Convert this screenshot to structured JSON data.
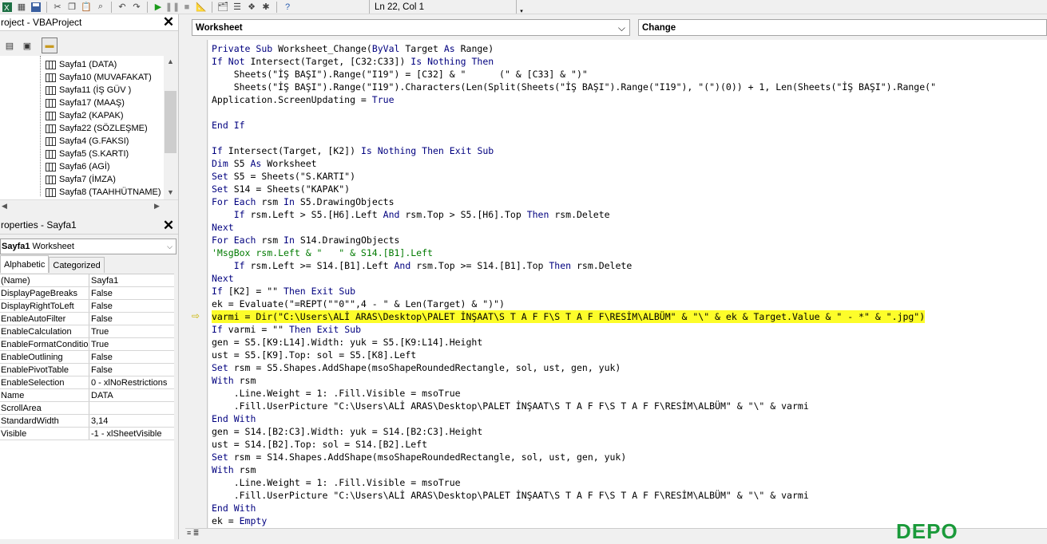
{
  "toolbar": {
    "status": "Ln 22, Col 1",
    "icons": [
      "excel-icon",
      "insert-module-icon",
      "save-icon",
      "cut-icon",
      "copy-icon",
      "paste-icon",
      "find-icon",
      "undo-icon",
      "redo-icon",
      "run-icon",
      "break-icon",
      "reset-icon",
      "design-mode-icon",
      "project-explorer-icon",
      "properties-icon",
      "object-browser-icon",
      "toolbox-icon",
      "help-icon"
    ]
  },
  "project": {
    "title": "roject - VBAProject",
    "close": "✕",
    "items": [
      "Sayfa1 (DATA)",
      "Sayfa10 (MUVAFAKAT)",
      "Sayfa11 (İŞ GÜV )",
      "Sayfa17 (MAAŞ)",
      "Sayfa2 (KAPAK)",
      "Sayfa22 (SÖZLEŞME)",
      "Sayfa4 (G.FAKSI)",
      "Sayfa5 (S.KARTI)",
      "Sayfa6 (AGİ)",
      "Sayfa7 (İMZA)",
      "Sayfa8 (TAAHHÜTNAME)"
    ]
  },
  "properties": {
    "title": "roperties - Sayfa1",
    "close": "✕",
    "object_name": "Sayfa1",
    "object_type": "Worksheet",
    "tabs": [
      "Alphabetic",
      "Categorized"
    ],
    "rows": [
      [
        "(Name)",
        "Sayfa1"
      ],
      [
        "DisplayPageBreaks",
        "False"
      ],
      [
        "DisplayRightToLeft",
        "False"
      ],
      [
        "EnableAutoFilter",
        "False"
      ],
      [
        "EnableCalculation",
        "True"
      ],
      [
        "EnableFormatConditionsCalculation",
        "True"
      ],
      [
        "EnableOutlining",
        "False"
      ],
      [
        "EnablePivotTable",
        "False"
      ],
      [
        "EnableSelection",
        "0 - xlNoRestrictions"
      ],
      [
        "Name",
        "DATA"
      ],
      [
        "ScrollArea",
        ""
      ],
      [
        "StandardWidth",
        "3,14"
      ],
      [
        "Visible",
        "-1 - xlSheetVisible"
      ]
    ]
  },
  "code": {
    "object_combo": "Worksheet",
    "procedure_combo": "Change",
    "lines": [
      "Private Sub Worksheet_Change(ByVal Target As Range)",
      "If Not Intersect(Target, [C32:C33]) Is Nothing Then",
      "    Sheets(\"İŞ BAŞI\").Range(\"I19\") = [C32] & \"      (\" & [C33] & \")\"",
      "    Sheets(\"İŞ BAŞI\").Range(\"I19\").Characters(Len(Split(Sheets(\"İŞ BAŞI\").Range(\"I19\"), \"(\")(0)) + 1, Len(Sheets(\"İŞ BAŞI\").Range(\"",
      "Application.ScreenUpdating = True",
      "",
      "End If",
      "",
      "If Intersect(Target, [K2]) Is Nothing Then Exit Sub",
      "Dim S5 As Worksheet",
      "Set S5 = Sheets(\"S.KARTI\")",
      "Set S14 = Sheets(\"KAPAK\")",
      "For Each rsm In S5.DrawingObjects",
      "    If rsm.Left > S5.[H6].Left And rsm.Top > S5.[H6].Top Then rsm.Delete",
      "Next",
      "For Each rsm In S14.DrawingObjects",
      "'MsgBox rsm.Left & \"   \" & S14.[B1].Left",
      "    If rsm.Left >= S14.[B1].Left And rsm.Top >= S14.[B1].Top Then rsm.Delete",
      "Next",
      "If [K2] = \"\" Then Exit Sub",
      "ek = Evaluate(\"=REPT(\"\"0\"\",4 - \" & Len(Target) & \")\")",
      "varmi = Dir(\"C:\\Users\\ALİ ARAS\\Desktop\\PALET İNŞAAT\\S T A F F\\S T A F F\\RESİM\\ALBÜM\" & \"\\\" & ek & Target.Value & \" - *\" & \".jpg\")",
      "If varmi = \"\" Then Exit Sub",
      "gen = S5.[K9:L14].Width: yuk = S5.[K9:L14].Height",
      "ust = S5.[K9].Top: sol = S5.[K8].Left",
      "Set rsm = S5.Shapes.AddShape(msoShapeRoundedRectangle, sol, ust, gen, yuk)",
      "With rsm",
      "    .Line.Weight = 1: .Fill.Visible = msoTrue",
      "    .Fill.UserPicture \"C:\\Users\\ALİ ARAS\\Desktop\\PALET İNŞAAT\\S T A F F\\S T A F F\\RESİM\\ALBÜM\" & \"\\\" & varmi",
      "End With",
      "gen = S14.[B2:C3].Width: yuk = S14.[B2:C3].Height",
      "ust = S14.[B2].Top: sol = S14.[B2].Left",
      "Set rsm = S14.Shapes.AddShape(msoShapeRoundedRectangle, sol, ust, gen, yuk)",
      "With rsm",
      "    .Line.Weight = 1: .Fill.Visible = msoTrue",
      "    .Fill.UserPicture \"C:\\Users\\ALİ ARAS\\Desktop\\PALET İNŞAAT\\S T A F F\\S T A F F\\RESİM\\ALBÜM\" & \"\\\" & varmi",
      "End With",
      "ek = Empty"
    ],
    "comment_line": 16,
    "highlight_line": 21,
    "keyword_color": "#00007f",
    "comment_color": "#007a00",
    "highlight_color": "#fdfd2a"
  },
  "watermark": "DEPO"
}
